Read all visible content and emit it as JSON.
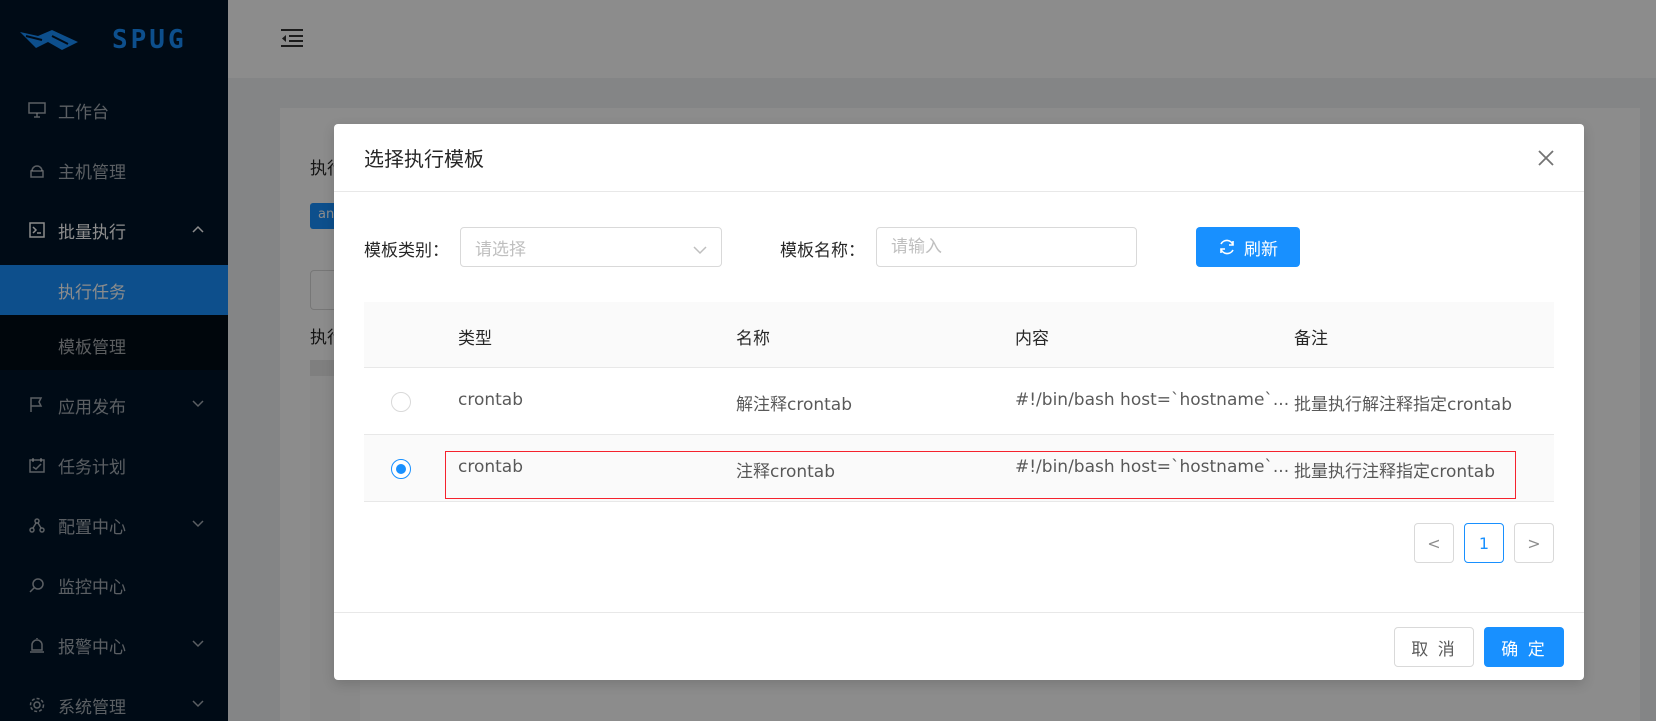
{
  "app": {
    "logo_text": "SPUG"
  },
  "sidebar": {
    "items": [
      {
        "label": "工作台",
        "icon": "desktop-icon"
      },
      {
        "label": "主机管理",
        "icon": "cloud-server-icon"
      },
      {
        "label": "批量执行",
        "icon": "code-icon",
        "open": true,
        "children": [
          {
            "label": "执行任务",
            "active": true
          },
          {
            "label": "模板管理"
          }
        ]
      },
      {
        "label": "应用发布",
        "icon": "flag-icon"
      },
      {
        "label": "任务计划",
        "icon": "schedule-icon"
      },
      {
        "label": "配置中心",
        "icon": "deployment-icon"
      },
      {
        "label": "监控中心",
        "icon": "monitor-icon"
      },
      {
        "label": "报警中心",
        "icon": "alert-icon"
      },
      {
        "label": "系统管理",
        "icon": "setting-icon"
      }
    ]
  },
  "background": {
    "label_1": "执行",
    "tag": "an",
    "label_2": "执行"
  },
  "modal": {
    "title": "选择执行模板",
    "filters": {
      "type_label": "模板类别：",
      "type_placeholder": "请选择",
      "name_label": "模板名称：",
      "name_placeholder": "请输入",
      "refresh_label": "刷新"
    },
    "table": {
      "columns": [
        "类型",
        "名称",
        "内容",
        "备注"
      ],
      "rows": [
        {
          "type": "crontab",
          "name": "解注释crontab",
          "content": "#!/bin/bash host=`hostname`...",
          "remark": "批量执行解注释指定crontab",
          "selected": false
        },
        {
          "type": "crontab",
          "name": "注释crontab",
          "content": "#!/bin/bash host=`hostname`...",
          "remark": "批量执行注释指定crontab",
          "selected": true
        }
      ]
    },
    "pagination": {
      "current": "1",
      "prev": "<",
      "next": ">"
    },
    "footer": {
      "cancel_label": "取 消",
      "ok_label": "确 定"
    }
  },
  "colors": {
    "primary": "#1890ff",
    "sidebar_bg": "#001529",
    "highlight": "#f5222d"
  }
}
